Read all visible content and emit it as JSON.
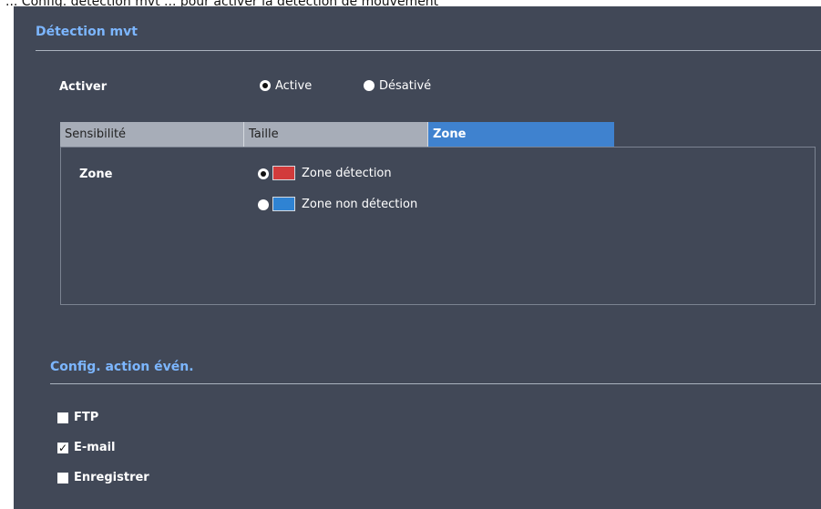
{
  "top_text": "... Config. détection mvt ... pour activer la détection de mouvement",
  "motion": {
    "section_title": "Détection mvt",
    "enable_label": "Activer",
    "option_active": "Active",
    "option_disabled": "Désativé",
    "tabs": [
      "Sensibilité",
      "Taille",
      "Zone"
    ],
    "active_tab": "Zone",
    "zone_label": "Zone",
    "zone_detection_label": "Zone détection",
    "zone_non_detection_label": "Zone non détection",
    "colors": {
      "detection": "#d23b3b",
      "non_detection": "#2f83d3"
    }
  },
  "event_action": {
    "section_title": "Config. action évén.",
    "items": [
      {
        "label": "FTP",
        "checked": false,
        "check_mark": ""
      },
      {
        "label": "E-mail",
        "checked": true,
        "check_mark": "✓"
      },
      {
        "label": "Enregistrer",
        "checked": false,
        "check_mark": ""
      }
    ]
  }
}
